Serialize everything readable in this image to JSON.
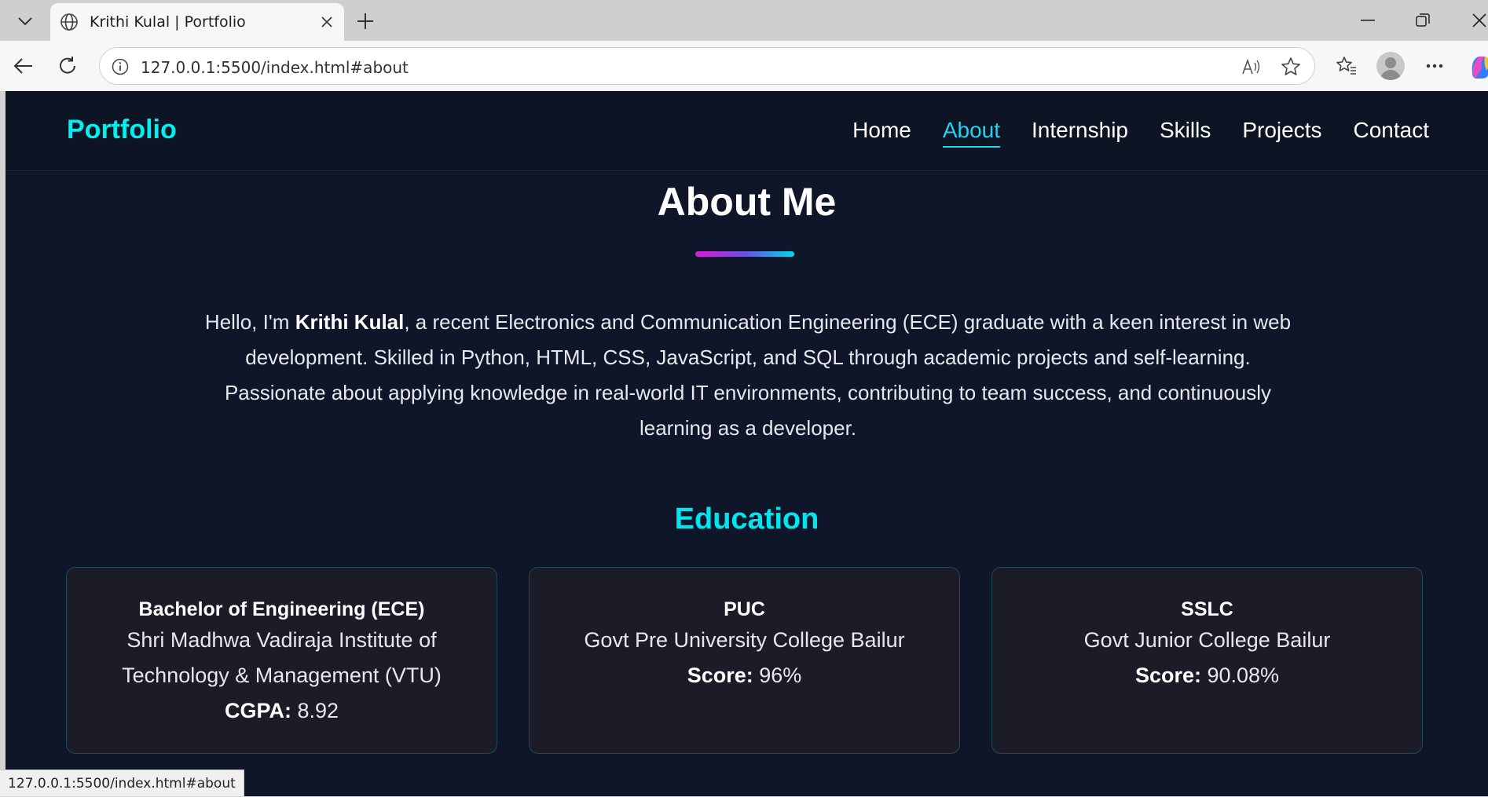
{
  "browser": {
    "tab_title": "Krithi Kulal | Portfolio",
    "url": "127.0.0.1:5500/index.html#about",
    "status_url": "127.0.0.1:5500/index.html#about"
  },
  "nav": {
    "brand": "Portfolio",
    "links": [
      {
        "label": "Home"
      },
      {
        "label": "About"
      },
      {
        "label": "Internship"
      },
      {
        "label": "Skills"
      },
      {
        "label": "Projects"
      },
      {
        "label": "Contact"
      }
    ],
    "active": "About"
  },
  "about": {
    "title": "About Me",
    "intro_prefix": "Hello, I'm ",
    "name": "Krithi Kulal",
    "intro_rest": ", a recent Electronics and Communication Engineering (ECE) graduate with a keen interest in web development. Skilled in Python, HTML, CSS, JavaScript, and SQL through academic projects and self-learning. Passionate about applying knowledge in real-world IT environments, contributing to team success, and continuously learning as a developer."
  },
  "education": {
    "title": "Education",
    "cards": [
      {
        "degree": "Bachelor of Engineering (ECE)",
        "school": "Shri Madhwa Vadiraja Institute of Technology & Management (VTU)",
        "score_label": "CGPA:",
        "score_value": " 8.92"
      },
      {
        "degree": "PUC",
        "school": "Govt Pre University College Bailur",
        "score_label": "Score:",
        "score_value": " 96%"
      },
      {
        "degree": "SSLC",
        "school": "Govt Junior College Bailur",
        "score_label": "Score:",
        "score_value": " 90.08%"
      }
    ]
  },
  "colors": {
    "page_bg": "#0f1629",
    "accent": "#00e5ee",
    "card_bg": "#1b1c28"
  }
}
